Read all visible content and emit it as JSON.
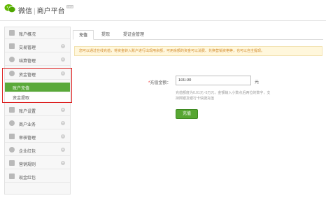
{
  "header": {
    "app_name": "微信",
    "separator": "|",
    "platform": "商户平台",
    "version_badge": "beta",
    "brand_color": "#62b900"
  },
  "sidebar": {
    "items": [
      {
        "label": "账户概况",
        "icon": "user-icon",
        "expandable": false
      },
      {
        "label": "交易管理",
        "icon": "grid-icon",
        "expandable": true
      },
      {
        "label": "结算管理",
        "icon": "clock-icon",
        "expandable": true
      },
      {
        "label": "资金管理",
        "icon": "gear-icon",
        "expandable": true,
        "expanded": true
      },
      {
        "label": "账户设置",
        "icon": "user-icon",
        "expandable": true
      },
      {
        "label": "商户业务",
        "icon": "gear-icon",
        "expandable": true
      },
      {
        "label": "审核管理",
        "icon": "grid-icon",
        "expandable": true
      },
      {
        "label": "企业红包",
        "icon": "dollar-icon",
        "expandable": true
      },
      {
        "label": "营销规则",
        "icon": "grid-icon",
        "expandable": true
      },
      {
        "label": "现金红包",
        "icon": "grid-icon",
        "expandable": false
      }
    ],
    "sub_items": [
      {
        "label": "账户充值",
        "active": true
      },
      {
        "label": "资金提取",
        "active": false
      }
    ],
    "active_color": "#5aa93a",
    "highlight_color": "#dd2222"
  },
  "tabs": [
    {
      "label": "充值",
      "active": true
    },
    {
      "label": "提现",
      "active": false
    },
    {
      "label": "提证金管理",
      "active": false
    }
  ],
  "notice": "您可以通过在线充值，将资金转入账户进行出现用余额，可用余额的资金可以消费、兑换营销资格等，也可以自主提现。",
  "form": {
    "label_required_mark": "*",
    "label": "充值金额：",
    "amount_value": "100.00",
    "unit": "元",
    "hint": "充值额度为0.01元~5万元，金额输入小数点后两位的数字，支持网银及银行卡快捷充值",
    "submit_label": "充值",
    "button_color": "#57a632"
  }
}
